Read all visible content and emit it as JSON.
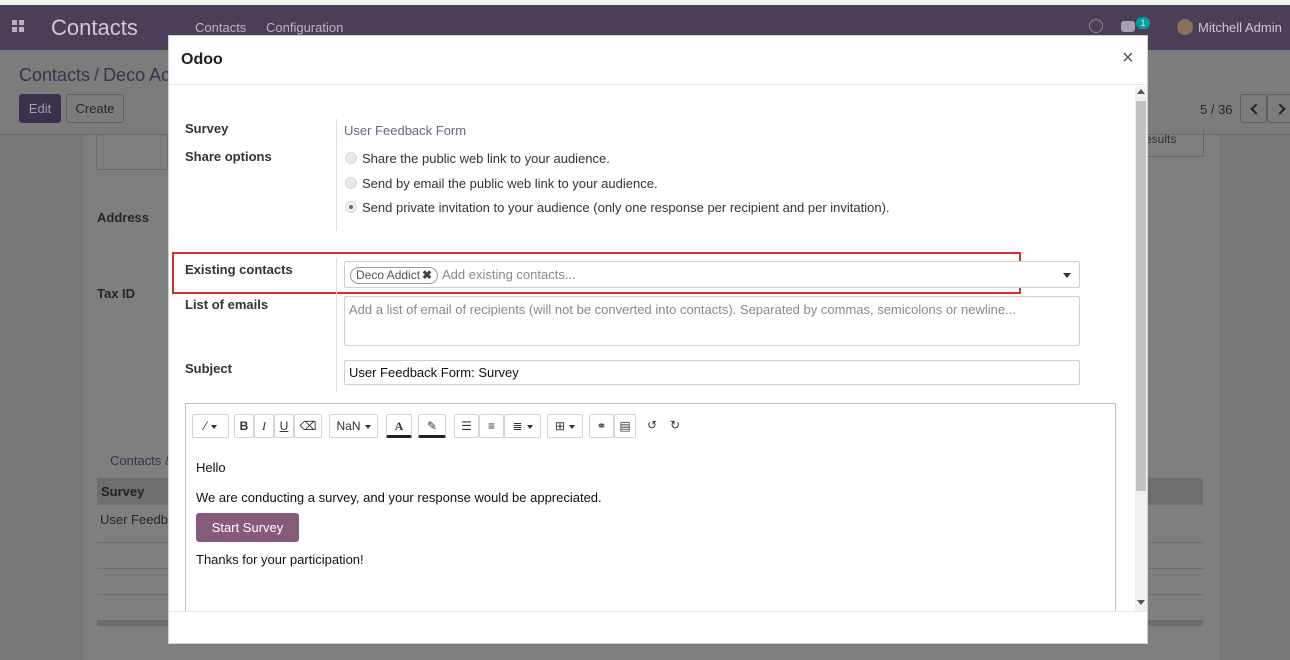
{
  "navbar": {
    "brand": "Contacts",
    "menu": [
      "Contacts",
      "Configuration"
    ],
    "badge_count": "1",
    "user": "Mitchell Admin"
  },
  "control_panel": {
    "breadcrumb_root": "Contacts",
    "breadcrumb_current": "Deco Ac",
    "edit_label": "Edit",
    "create_label": "Create",
    "pager": "5 / 36"
  },
  "background_form": {
    "address_label": "Address",
    "taxid_label": "Tax ID",
    "results_label": "esults",
    "tab_label": "Contacts &",
    "table_header": "Survey",
    "table_cell": "User Feedb"
  },
  "modal": {
    "title": "Odoo",
    "close_symbol": "×",
    "survey_label": "Survey",
    "survey_value": "User Feedback Form",
    "share_label": "Share options",
    "share_options": [
      "Share the public web link to your audience.",
      "Send by email the public web link to your audience.",
      "Send private invitation to your audience (only one response per recipient and per invitation)."
    ],
    "selected_share_option_index": 2,
    "contacts_label": "Existing contacts",
    "contact_tag": "Deco Addict",
    "contacts_placeholder": "Add existing contacts...",
    "emails_label": "List of emails",
    "emails_placeholder": "Add a list of email of recipients (will not be converted into contacts). Separated by commas, semicolons or newline...",
    "subject_label": "Subject",
    "subject_value": "User Feedback Form: Survey"
  },
  "editor": {
    "font_size_label": "NaN",
    "toolbar_glyphs": {
      "bold": "B",
      "italic": "I",
      "underline": "U",
      "font_color": "A",
      "undo": "↺",
      "redo": "↻"
    },
    "body": {
      "greeting": "Hello",
      "message": "We are conducting a survey, and your response would be appreciated.",
      "button": "Start Survey",
      "closing": "Thanks for your participation!"
    }
  },
  "colors": {
    "navbar": "#4b3e59",
    "primary": "#875a7b",
    "link": "#6d5f8a",
    "highlight": "#d32f2f"
  }
}
